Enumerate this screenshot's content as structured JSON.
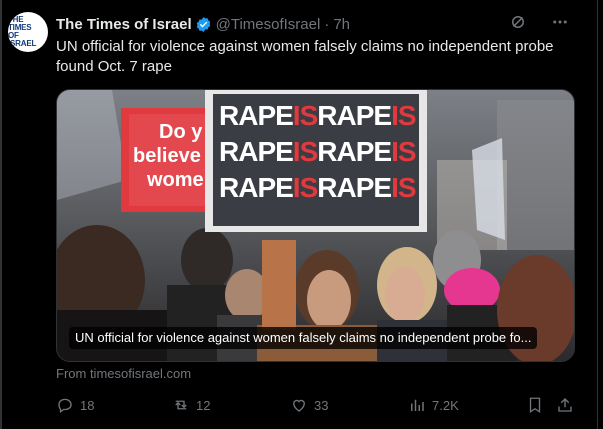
{
  "avatar": {
    "line1": "THE TIMES",
    "line2": "OF ISRAEL"
  },
  "header": {
    "name": "The Times of Israel",
    "handle": "@TimesofIsrael",
    "separator": "·",
    "time": "7h"
  },
  "tweet": {
    "text": "UN official for violence against women falsely claims no independent probe found Oct. 7 rape"
  },
  "card": {
    "caption": "UN official for violence against women falsely claims no independent probe fo...",
    "sign_lines": [
      [
        "RAPE",
        "IS",
        "RAPE",
        "IS"
      ],
      [
        "RAPE",
        "IS",
        "RAPE",
        "IS"
      ],
      [
        "RAPE",
        "IS",
        "RAPE",
        "IS"
      ]
    ],
    "red_sign": [
      "Do y",
      "believe",
      "wome"
    ],
    "source": "From timesofisrael.com"
  },
  "actions": {
    "replies": "18",
    "reposts": "12",
    "likes": "33",
    "views": "7.2K"
  },
  "colors": {
    "background": "#000000",
    "text": "#e7e9ea",
    "muted": "#71767b",
    "verified": "#1d9bf0",
    "sign_red": "#e0393e"
  }
}
